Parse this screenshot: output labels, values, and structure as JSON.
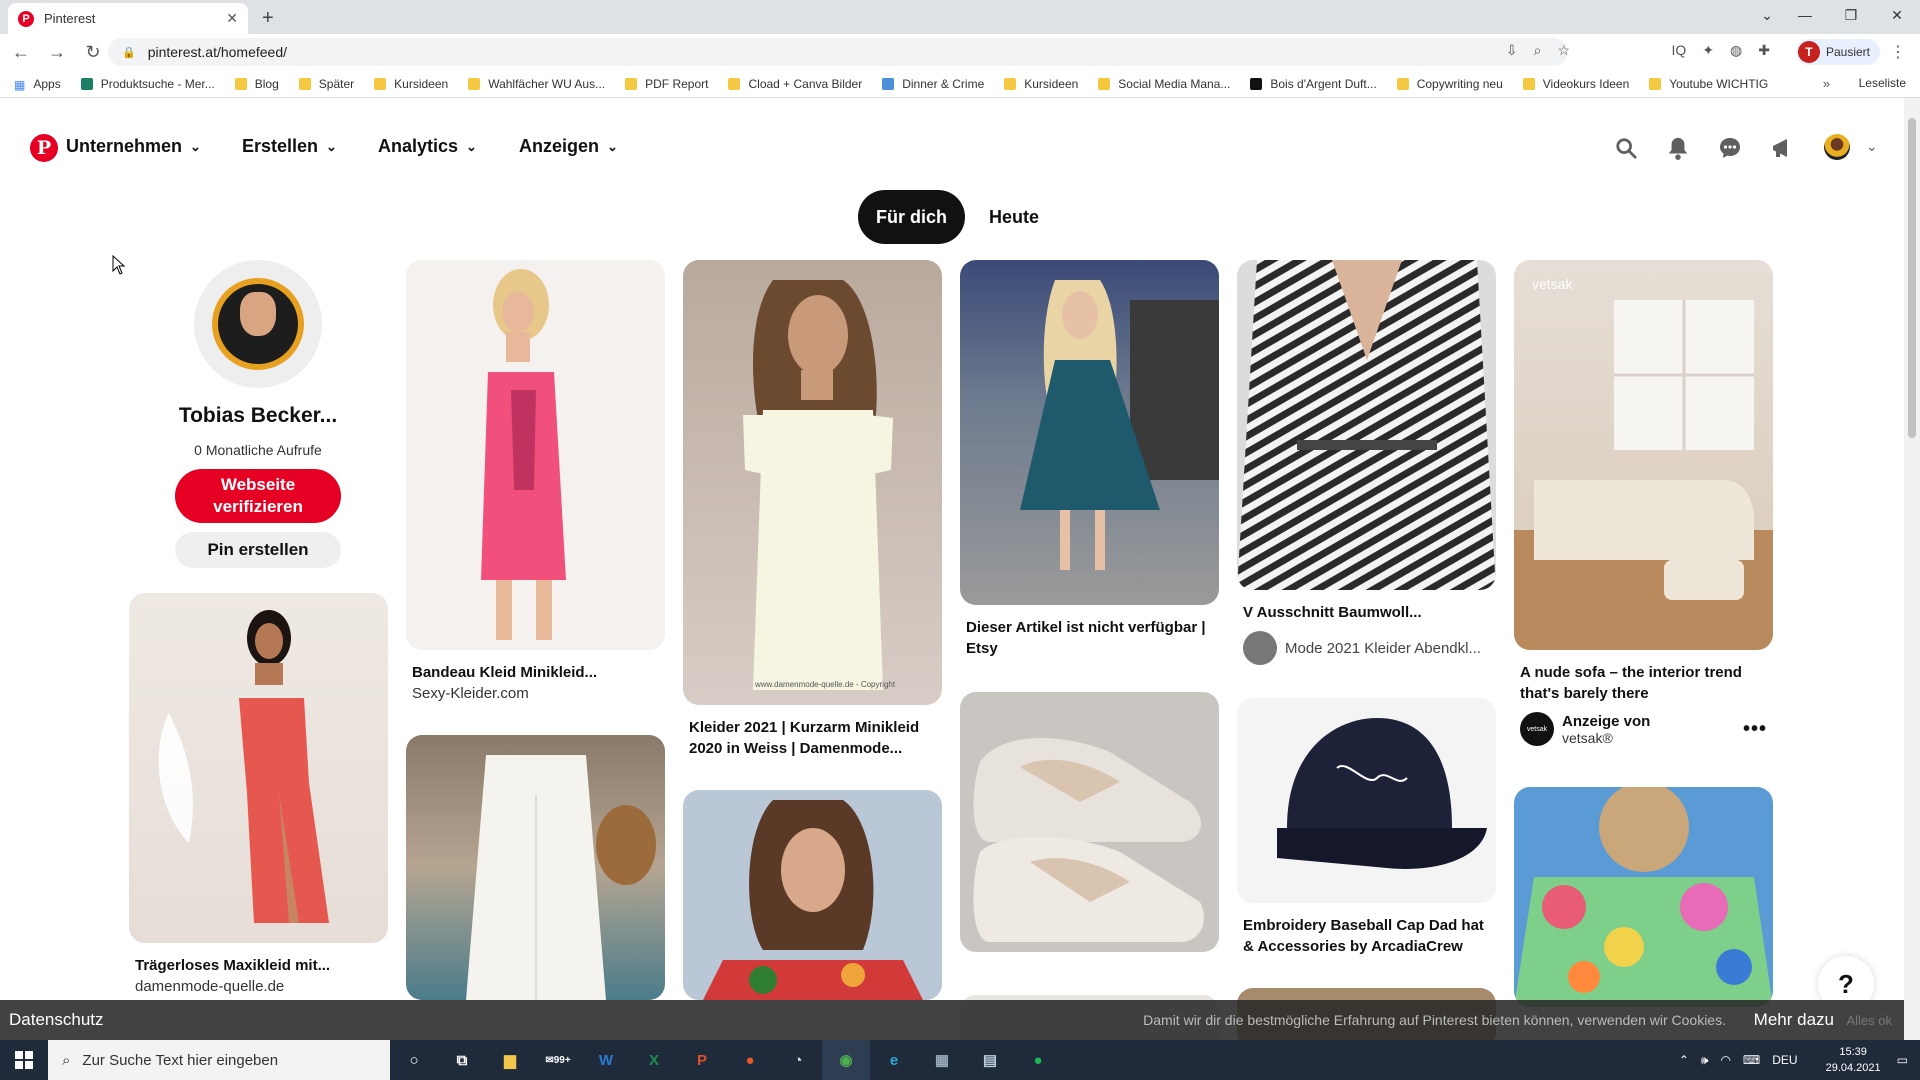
{
  "browser": {
    "tab_title": "Pinterest",
    "url": "pinterest.at/homefeed/",
    "profile_initial": "T",
    "profile_status": "Pausiert",
    "bookmarks": [
      {
        "label": "Apps",
        "icon": "apps"
      },
      {
        "label": "Produktsuche - Mer...",
        "icon": "green"
      },
      {
        "label": "Blog",
        "icon": "folder"
      },
      {
        "label": "Später",
        "icon": "folder"
      },
      {
        "label": "Kursideen",
        "icon": "folder"
      },
      {
        "label": "Wahlfächer WU Aus...",
        "icon": "folder"
      },
      {
        "label": "PDF Report",
        "icon": "folder"
      },
      {
        "label": "Cload + Canva Bilder",
        "icon": "folder"
      },
      {
        "label": "Dinner & Crime",
        "icon": "blue"
      },
      {
        "label": "Kursideen",
        "icon": "folder"
      },
      {
        "label": "Social Media Mana...",
        "icon": "folder"
      },
      {
        "label": "Bois d'Argent Duft...",
        "icon": "dark"
      },
      {
        "label": "Copywriting neu",
        "icon": "folder"
      },
      {
        "label": "Videokurs Ideen",
        "icon": "folder"
      },
      {
        "label": "Youtube WICHTIG",
        "icon": "folder"
      }
    ],
    "reading_list": "Leseliste"
  },
  "nav": {
    "items": [
      "Unternehmen",
      "Erstellen",
      "Analytics",
      "Anzeigen"
    ]
  },
  "feed_tabs": {
    "active": "Für dich",
    "inactive": "Heute"
  },
  "profile": {
    "name": "Tobias Becker...",
    "views": "0 Monatliche Aufrufe",
    "verify_label": "Webseite verifizieren",
    "create_pin_label": "Pin erstellen"
  },
  "pins": {
    "trager": {
      "title": "Trägerloses Maxikleid mit...",
      "source": "damenmode-quelle.de"
    },
    "bandeau": {
      "title": "Bandeau Kleid Minikleid...",
      "source": "Sexy-Kleider.com"
    },
    "kleider": {
      "title": "Kleider 2021 | Kurzarm Minikleid 2020 in Weiss | Damenmode...",
      "watermark": "www.damenmode-quelle.de - Copyright"
    },
    "artikel": {
      "title": "Dieser Artikel ist nicht verfügbar | Etsy"
    },
    "vaus": {
      "title": "V Ausschnitt Baumwoll...",
      "owner": "Mode 2021 Kleider Abendkl..."
    },
    "cap": {
      "title": "Embroidery Baseball Cap Dad hat & Accessories by ArcadiaCrew"
    },
    "sofa": {
      "title": "A nude sofa – the interior trend that's barely there",
      "watermark": "vetsak",
      "ad_label": "Anzeige von",
      "ad_source": "vetsak®",
      "ad_avatar": "vetsak"
    }
  },
  "cookie": {
    "left": "Datenschutz",
    "text": "Damit wir dir die bestmögliche Erfahrung auf Pinterest bieten können, verwenden wir Cookies.",
    "more": "Mehr dazu",
    "accept": "Alles ok"
  },
  "taskbar": {
    "search_placeholder": "Zur Suche Text hier eingeben",
    "mail_badge": "99+",
    "lang": "DEU",
    "time": "15:39",
    "date": "29.04.2021"
  },
  "colors": {
    "brand": "#e60023",
    "dark": "#111111"
  }
}
